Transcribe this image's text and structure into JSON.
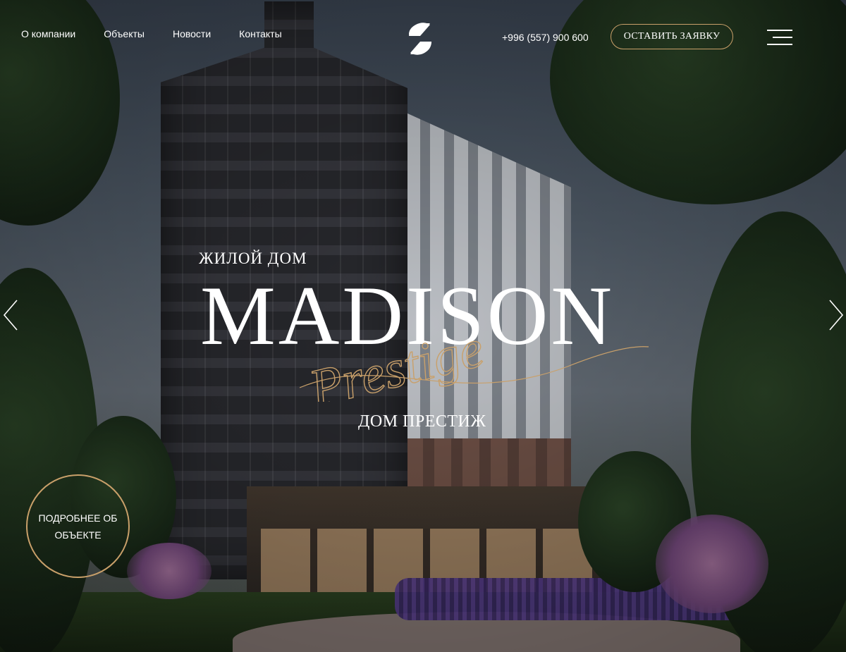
{
  "header": {
    "nav": [
      {
        "label": "О компании"
      },
      {
        "label": "Объекты"
      },
      {
        "label": "Новости"
      },
      {
        "label": "Контакты"
      }
    ],
    "logo_icon": "capstroy-s-logo",
    "phone": "+996 (557) 900 600",
    "cta_label": "ОСТАВИТЬ ЗАЯВКУ",
    "menu_icon": "hamburger-menu-icon"
  },
  "hero": {
    "eyebrow": "ЖИЛОЙ ДОМ",
    "title": "MADISON",
    "script_word": "Prestige",
    "subtitle": "ДОМ ПРЕСТИЖ",
    "more_label": "ПОДРОБНЕЕ ОБ ОБЪЕКТЕ",
    "prev_icon": "chevron-left-icon",
    "next_icon": "chevron-right-icon"
  },
  "colors": {
    "accent_gold": "#c9a06a",
    "text": "#ffffff"
  }
}
